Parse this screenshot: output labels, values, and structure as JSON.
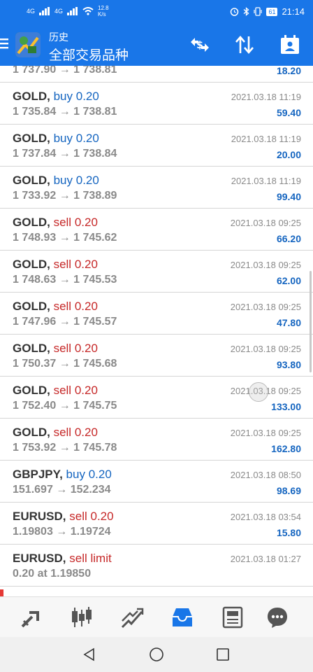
{
  "status_bar": {
    "signal1": "4G",
    "signal2": "4G",
    "speed": "12.8",
    "speed_unit": "K/s",
    "battery": "61",
    "time": "21:14"
  },
  "app_bar": {
    "subtitle": "历史",
    "title": "全部交易品种",
    "icons": [
      "menu-icon",
      "app-logo",
      "currency-exchange-icon",
      "sort-icon",
      "calendar-icon"
    ]
  },
  "partial_top_row": {
    "prices": "1 737.90 → 1 738.81",
    "profit": "18.20"
  },
  "trades": [
    {
      "symbol": "GOLD,",
      "side": "buy",
      "lot": "0.20",
      "prices": "1 735.84 → 1 738.81",
      "time": "2021.03.18 11:19",
      "profit": "59.40"
    },
    {
      "symbol": "GOLD,",
      "side": "buy",
      "lot": "0.20",
      "prices": "1 737.84 → 1 738.84",
      "time": "2021.03.18 11:19",
      "profit": "20.00"
    },
    {
      "symbol": "GOLD,",
      "side": "buy",
      "lot": "0.20",
      "prices": "1 733.92 → 1 738.89",
      "time": "2021.03.18 11:19",
      "profit": "99.40"
    },
    {
      "symbol": "GOLD,",
      "side": "sell",
      "lot": "0.20",
      "prices": "1 748.93 → 1 745.62",
      "time": "2021.03.18 09:25",
      "profit": "66.20"
    },
    {
      "symbol": "GOLD,",
      "side": "sell",
      "lot": "0.20",
      "prices": "1 748.63 → 1 745.53",
      "time": "2021.03.18 09:25",
      "profit": "62.00"
    },
    {
      "symbol": "GOLD,",
      "side": "sell",
      "lot": "0.20",
      "prices": "1 747.96 → 1 745.57",
      "time": "2021.03.18 09:25",
      "profit": "47.80"
    },
    {
      "symbol": "GOLD,",
      "side": "sell",
      "lot": "0.20",
      "prices": "1 750.37 → 1 745.68",
      "time": "2021.03.18 09:25",
      "profit": "93.80"
    },
    {
      "symbol": "GOLD,",
      "side": "sell",
      "lot": "0.20",
      "prices": "1 752.40 → 1 745.75",
      "time": "2021.03.18 09:25",
      "profit": "133.00"
    },
    {
      "symbol": "GOLD,",
      "side": "sell",
      "lot": "0.20",
      "prices": "1 753.92 → 1 745.78",
      "time": "2021.03.18 09:25",
      "profit": "162.80"
    },
    {
      "symbol": "GBPJPY,",
      "side": "buy",
      "lot": "0.20",
      "prices": "151.697 → 152.234",
      "time": "2021.03.18 08:50",
      "profit": "98.69"
    },
    {
      "symbol": "EURUSD,",
      "side": "sell",
      "lot": "0.20",
      "prices": "1.19803 → 1.19724",
      "time": "2021.03.18 03:54",
      "profit": "15.80"
    },
    {
      "symbol": "EURUSD,",
      "side": "sell limit",
      "lot": "",
      "prices": "0.20 at 1.19850",
      "time": "2021.03.18 01:27",
      "profit": ""
    }
  ],
  "colors": {
    "accent": "#1976e8",
    "buy": "#1565c0",
    "sell": "#c62828",
    "profit": "#1565c0"
  },
  "bottom_nav": [
    "quotes-icon",
    "chart-icon",
    "trade-icon",
    "history-icon",
    "news-icon",
    "chat-icon"
  ],
  "system_nav": [
    "back-icon",
    "home-icon",
    "recents-icon"
  ]
}
